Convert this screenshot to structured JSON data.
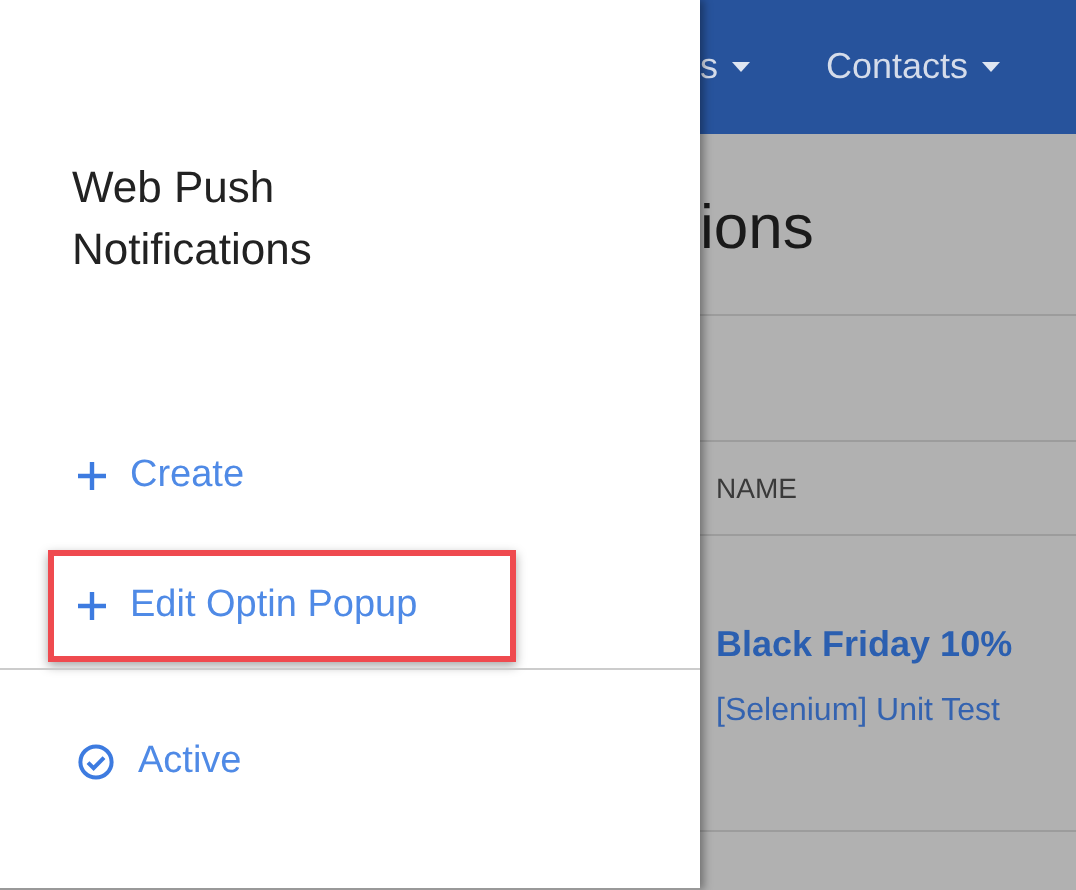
{
  "panel": {
    "title": "Web Push Notifications",
    "items": [
      {
        "kind": "action",
        "label": "Create",
        "highlighted": false
      },
      {
        "kind": "action",
        "label": "Edit Optin Popup",
        "highlighted": true
      },
      {
        "kind": "status",
        "label": "Active",
        "highlighted": false
      }
    ]
  },
  "navbar": {
    "items": [
      {
        "label": "s"
      },
      {
        "label": "Contacts"
      }
    ]
  },
  "page": {
    "heading": "ions",
    "table": {
      "columns": [
        "NAME"
      ],
      "rows": [
        {
          "title": "Black Friday 10%",
          "subtitle": "[Selenium] Unit Test"
        }
      ]
    }
  }
}
